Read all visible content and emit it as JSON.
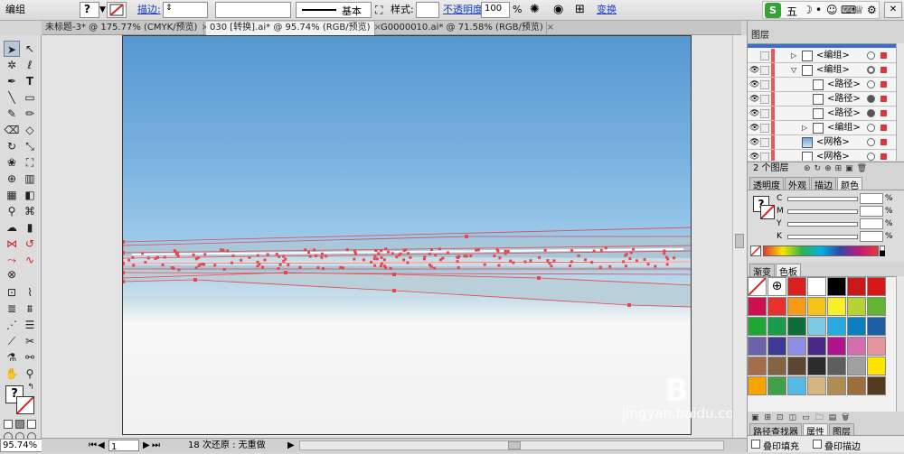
{
  "toolbar": {
    "group_label": "编组",
    "question_glyph": "?",
    "stroke_label": "描边:",
    "basic_label": "基本",
    "style_label": "样式:",
    "opacity_label": "不透明度:",
    "opacity_value": "100",
    "percent": "%",
    "transform_label": "变换"
  },
  "ime": {
    "five": "五",
    "moon": "☽",
    "dot": "•",
    "emoji": "☺",
    "kbd": "⌨",
    "shirt": "♕",
    "gear": "⚙"
  },
  "tabs": [
    {
      "label": "未标题-3* @ 175.77% (CMYK/预览)",
      "active": false
    },
    {
      "label": "030 [转换].ai* @ 95.74% (RGB/预览)",
      "active": true
    },
    {
      "label": "G0000010.ai* @ 71.58% (RGB/预览)",
      "active": false
    }
  ],
  "tab_close": "×",
  "status": {
    "zoom": "95.74%",
    "page": "1",
    "undo_text": "18 次还原 : 无重做"
  },
  "layers": {
    "title": "图层",
    "rows": [
      {
        "label": "<编组>",
        "indent": 1
      },
      {
        "label": "<编组>",
        "indent": 1
      },
      {
        "label": "<路径>",
        "indent": 2
      },
      {
        "label": "<路径>",
        "indent": 2
      },
      {
        "label": "<路径>",
        "indent": 2
      },
      {
        "label": "<编组>",
        "indent": 1
      },
      {
        "label": "<网格>",
        "indent": 1
      },
      {
        "label": "<网格>",
        "indent": 1
      }
    ],
    "footer": "2 个图层"
  },
  "panel2": {
    "tabs": [
      "透明度",
      "外观",
      "描边",
      "颜色"
    ],
    "active": 3,
    "channels": [
      "C",
      "M",
      "Y",
      "K"
    ],
    "percent": "%"
  },
  "panel3": {
    "tabs": [
      "渐变",
      "色板"
    ],
    "active": 1
  },
  "panel4": {
    "tabs": [
      "路径查找器",
      "属性",
      "图层"
    ],
    "labels": [
      "叠印填充",
      "叠印描边"
    ]
  },
  "watermark": {
    "line1": "Bai 经验",
    "line2": "jingyan.baidu.com"
  },
  "swatches": [
    "#d8201e",
    "#ffffff",
    "#000000",
    "#c8181c",
    "#d71818",
    "#cc1050",
    "#e8312e",
    "#f39b1a",
    "#f6c21c",
    "#f6ef2a",
    "#b5d334",
    "#62b530",
    "#1ea735",
    "#1a9a4d",
    "#0d6e3b",
    "#7dc9e6",
    "#27a9e1",
    "#0d7ec0",
    "#1c5fa8",
    "#6d62aa",
    "#3e3a94",
    "#8d8ee4",
    "#4a2a88",
    "#b2138c",
    "#d46db0",
    "#e4959d",
    "#a36d47",
    "#826444",
    "#5c4531",
    "#2c2c2c",
    "#5e5e5e",
    "#a0a0a0",
    "#ffe400",
    "#f8a300",
    "#3ea14a",
    "#57b8e6",
    "#d6b680",
    "#b18c52",
    "#9d6d3e",
    "#553a22"
  ]
}
